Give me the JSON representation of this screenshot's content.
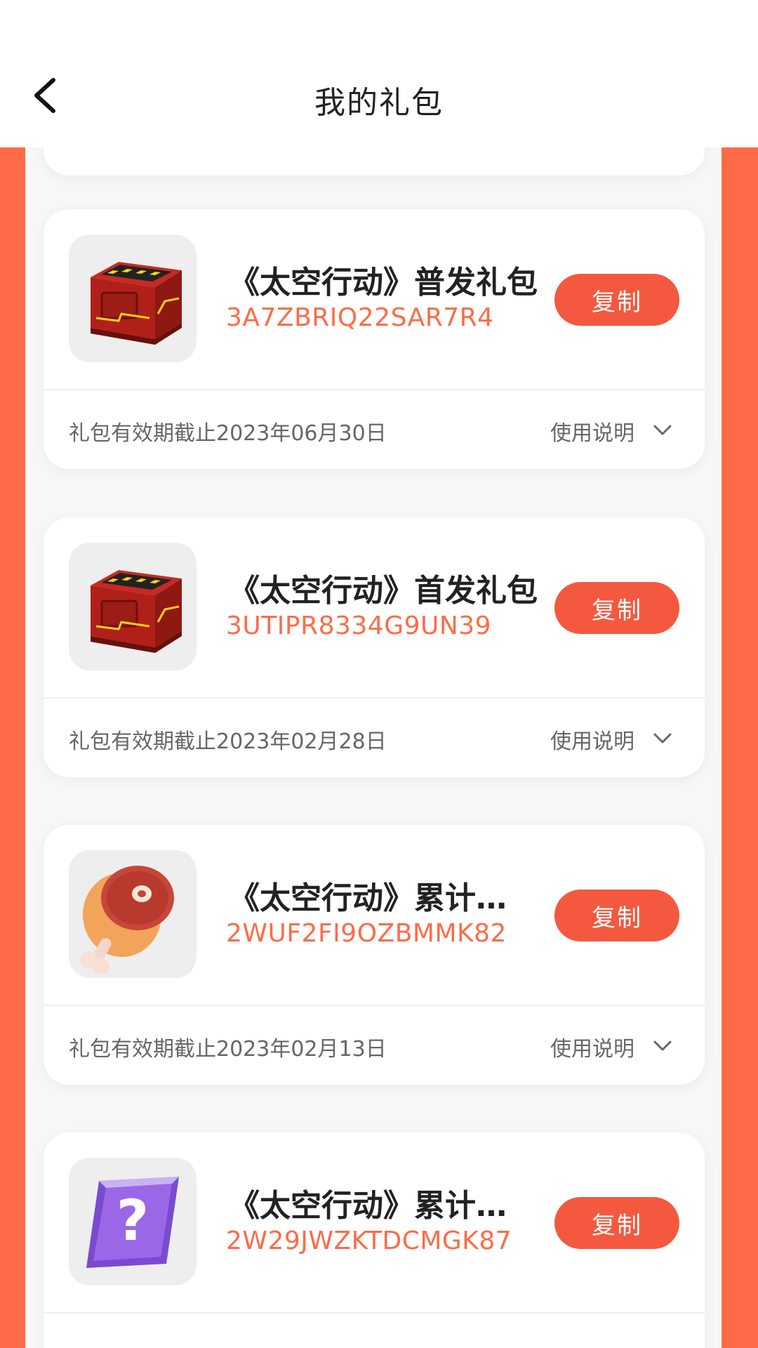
{
  "header": {
    "title": "我的礼包",
    "back_icon": "chevron-left-icon"
  },
  "colors": {
    "accent": "#f4593f",
    "code": "#ff6b47",
    "background_orange": "#ff6b47"
  },
  "copy_label": "复制",
  "usage_label": "使用说明",
  "gifts": [
    {
      "name": "《太空行动》普发礼包",
      "code": "3A7ZBRIQ22SAR7R4",
      "expiry": "礼包有效期截止2023年06月30日",
      "icon": "red-crate-icon"
    },
    {
      "name": "《太空行动》首发礼包",
      "code": "3UTIPR8334G9UN39",
      "expiry": "礼包有效期截止2023年02月28日",
      "icon": "red-crate-icon"
    },
    {
      "name": "《太空行动》累计…",
      "code": "2WUF2FI9OZBMMK82",
      "expiry": "礼包有效期截止2023年02月13日",
      "icon": "meat-icon"
    },
    {
      "name": "《太空行动》累计…",
      "code": "2W29JWZKTDCMGK87",
      "expiry": "",
      "icon": "mystery-box-icon"
    }
  ]
}
